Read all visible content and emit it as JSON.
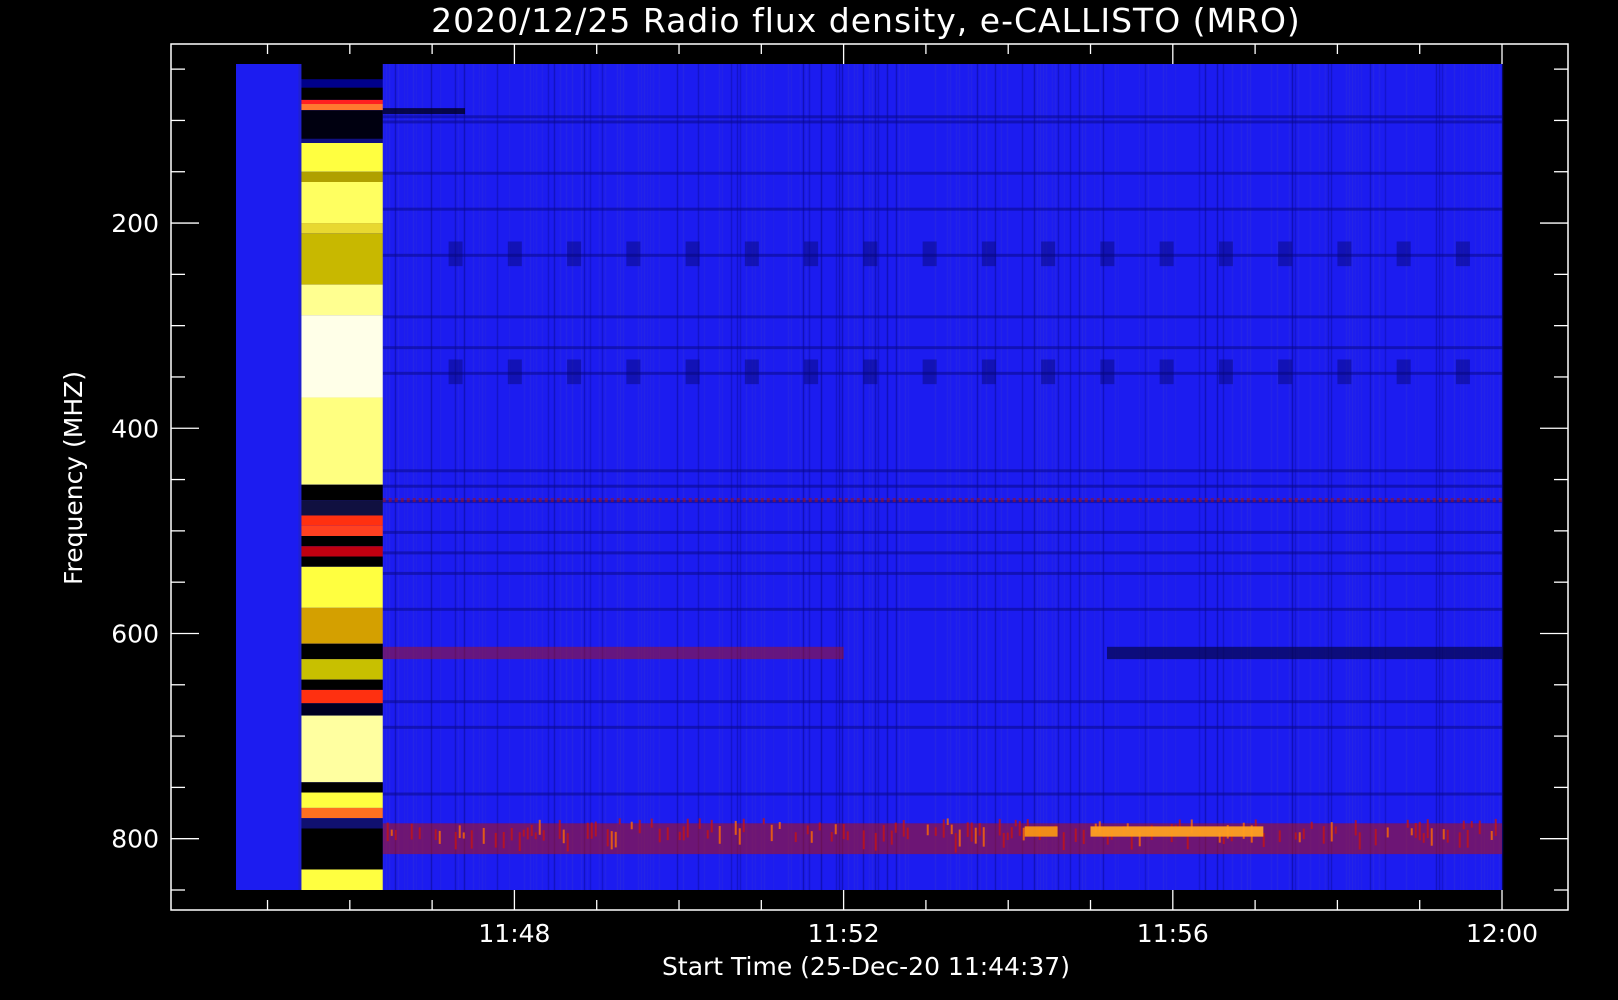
{
  "chart_data": {
    "type": "heatmap",
    "title": "2020/12/25  Radio flux density, e-CALLISTO (MRO)",
    "xlabel": "Start Time (25-Dec-20 11:44:37)",
    "ylabel": "Frequency (MHZ)",
    "x_ticks": [
      "11:48",
      "11:52",
      "11:56",
      "12:00"
    ],
    "x_tick_minutes": [
      48,
      52,
      56,
      60
    ],
    "x_range_minutes": [
      44.617,
      60
    ],
    "y_ticks": [
      "200",
      "400",
      "600",
      "800"
    ],
    "y_tick_values": [
      200,
      400,
      600,
      800
    ],
    "y_range": [
      850,
      45
    ],
    "y_reversed": true,
    "colors": {
      "background": "#000000",
      "low": "#1c1cf0",
      "mid": "#b01010",
      "high": "#ffff40"
    },
    "calibration_strip_minutes": [
      45.4,
      46.4
    ],
    "features": [
      {
        "label": "",
        "band_mhz": [
          780,
          810
        ],
        "time_minutes": [
          46.4,
          60
        ],
        "level": "high"
      },
      {
        "label": "",
        "band_mhz": [
          610,
          630
        ],
        "time_minutes": [
          46.4,
          60
        ],
        "level": "mid"
      }
    ]
  }
}
